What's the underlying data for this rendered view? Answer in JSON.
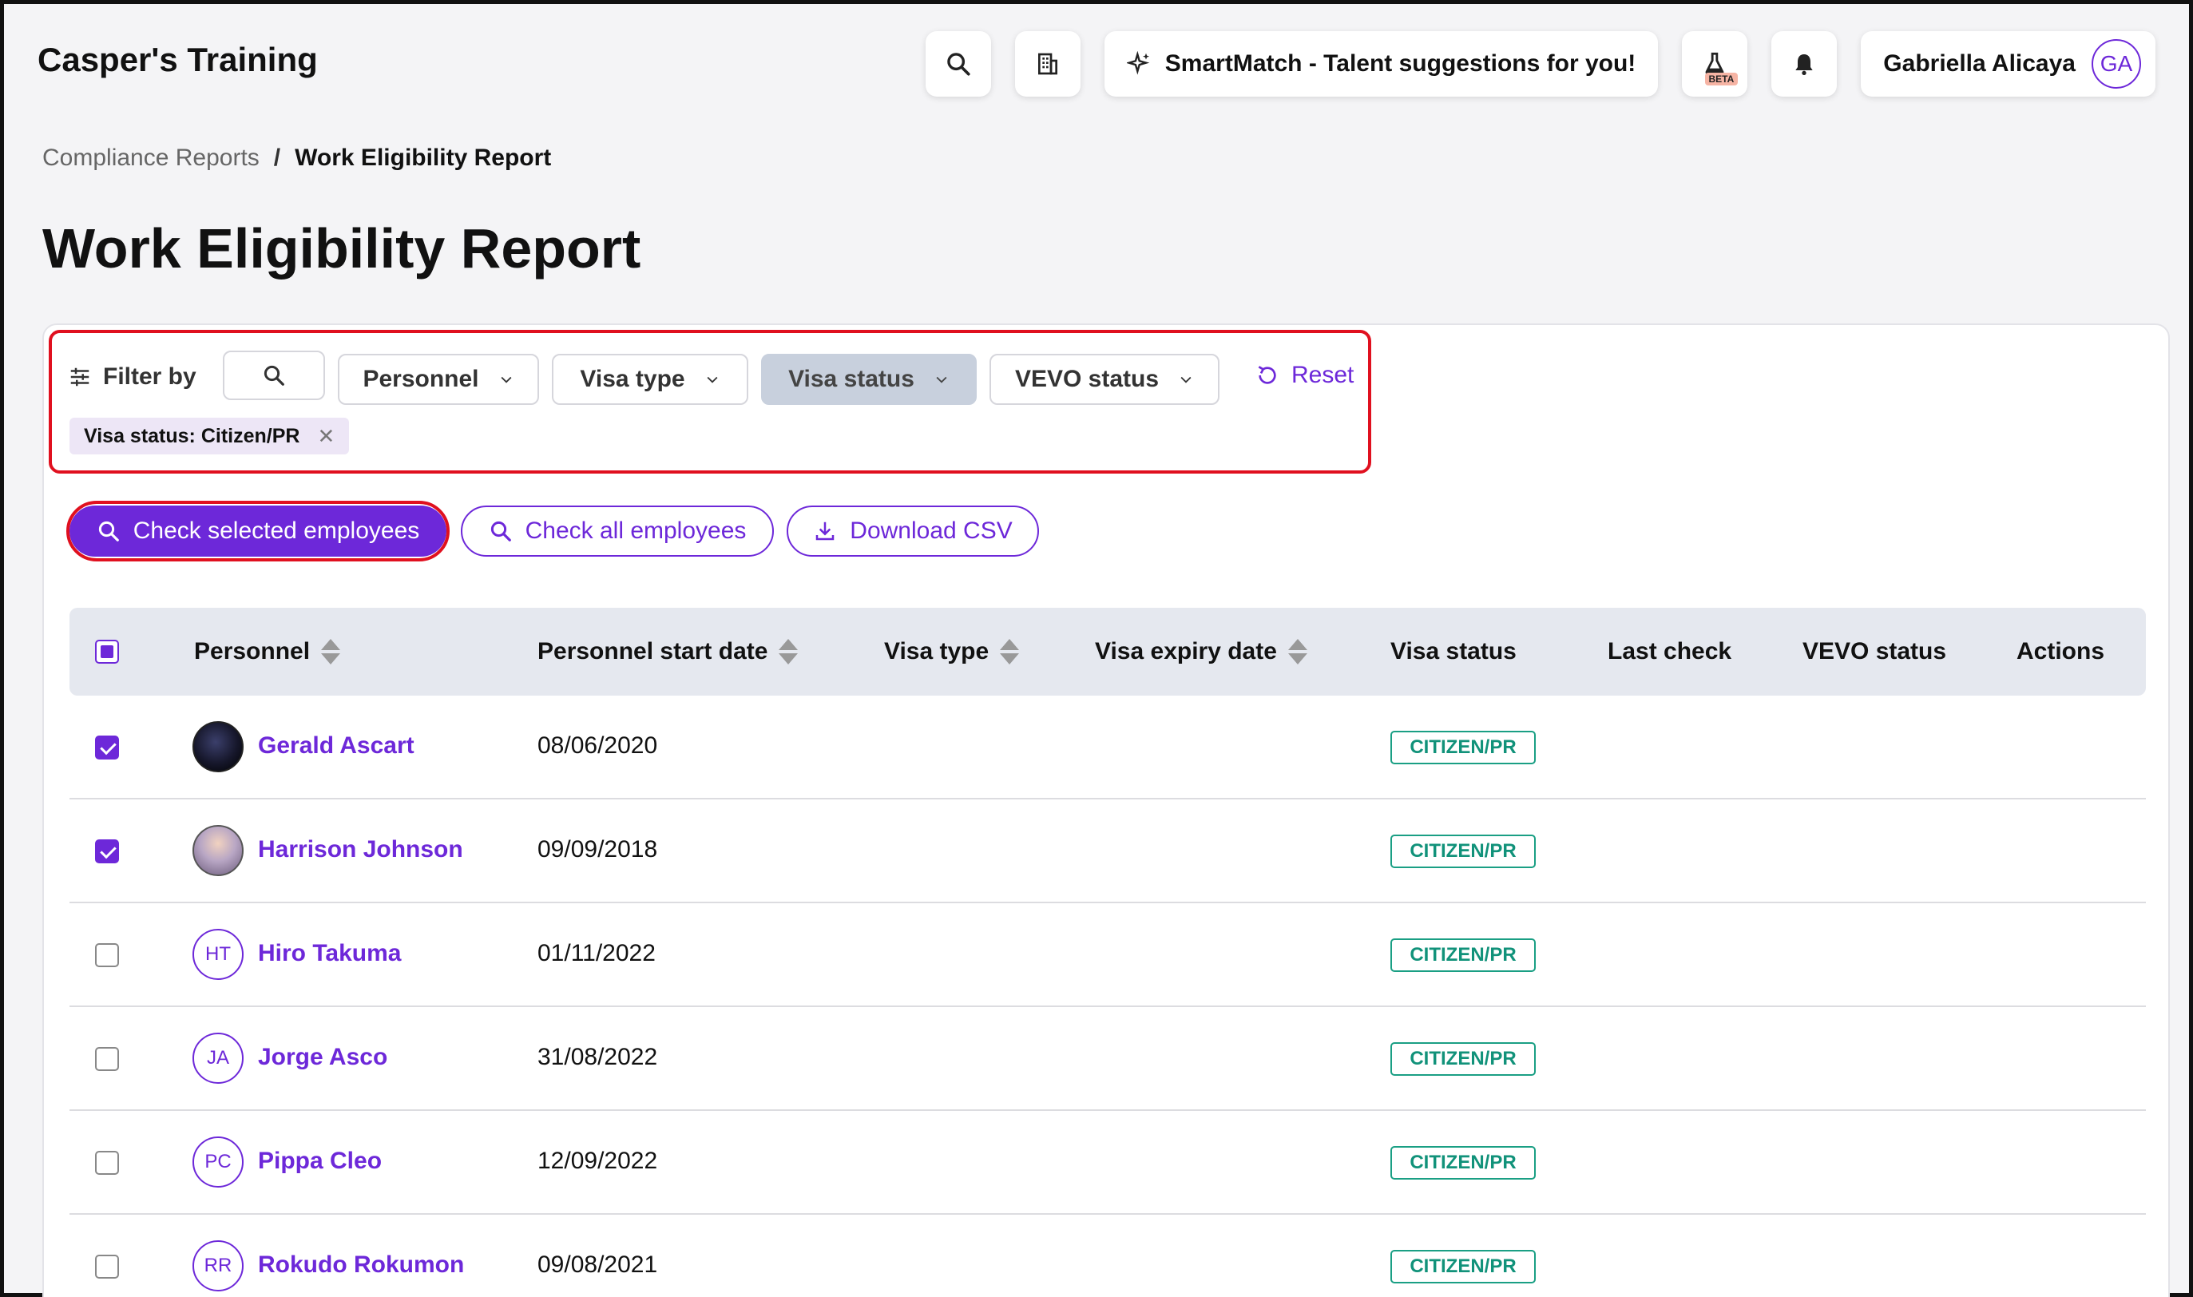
{
  "app": {
    "title": "Casper's Training"
  },
  "topbar": {
    "search_icon": "search-icon",
    "company_icon": "building-icon",
    "smartmatch_label": "SmartMatch - Talent suggestions for you!",
    "beta_label": "BETA",
    "user_name": "Gabriella Alicaya",
    "user_initials": "GA"
  },
  "breadcrumb": {
    "parent": "Compliance Reports",
    "separator": "/",
    "current": "Work Eligibility Report"
  },
  "page": {
    "title": "Work Eligibility Report"
  },
  "filters": {
    "label": "Filter by",
    "dropdowns": [
      "Personnel",
      "Visa type",
      "Visa status",
      "VEVO status"
    ],
    "active_dropdown": "Visa status",
    "reset_label": "Reset",
    "chips": [
      {
        "label": "Visa status: Citizen/PR"
      }
    ]
  },
  "actions": {
    "check_selected": "Check selected employees",
    "check_all": "Check all employees",
    "download_csv": "Download CSV"
  },
  "table": {
    "columns": [
      "Personnel",
      "Personnel start date",
      "Visa type",
      "Visa expiry date",
      "Visa status",
      "Last check",
      "VEVO status",
      "Actions"
    ],
    "rows": [
      {
        "name": "Gerald Ascart",
        "initials": "",
        "start_date": "08/06/2020",
        "visa_status": "CITIZEN/PR",
        "checked": true
      },
      {
        "name": "Harrison Johnson",
        "initials": "",
        "start_date": "09/09/2018",
        "visa_status": "CITIZEN/PR",
        "checked": true
      },
      {
        "name": "Hiro Takuma",
        "initials": "HT",
        "start_date": "01/11/2022",
        "visa_status": "CITIZEN/PR",
        "checked": false
      },
      {
        "name": "Jorge Asco",
        "initials": "JA",
        "start_date": "31/08/2022",
        "visa_status": "CITIZEN/PR",
        "checked": false
      },
      {
        "name": "Pippa Cleo",
        "initials": "PC",
        "start_date": "12/09/2022",
        "visa_status": "CITIZEN/PR",
        "checked": false
      },
      {
        "name": "Rokudo Rokumon",
        "initials": "RR",
        "start_date": "09/08/2021",
        "visa_status": "CITIZEN/PR",
        "checked": false
      }
    ]
  },
  "colors": {
    "accent": "#6d28d9",
    "highlight": "#e0101f",
    "badge": "#1a9f84"
  }
}
